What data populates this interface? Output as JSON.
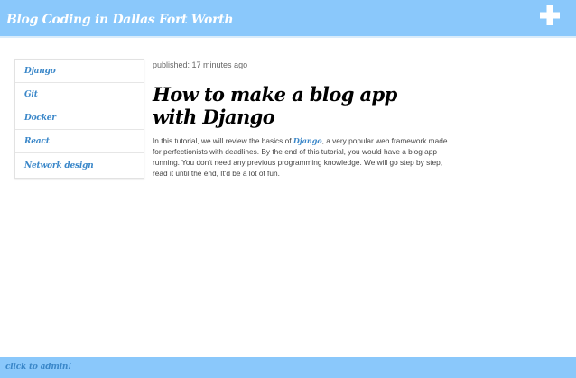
{
  "header": {
    "title": "Blog Coding in Dallas Fort Worth",
    "add_icon": "plus-icon",
    "color": "#8ac8fb"
  },
  "sidebar": {
    "items": [
      {
        "label": "Django"
      },
      {
        "label": "Git"
      },
      {
        "label": "Docker"
      },
      {
        "label": "React"
      },
      {
        "label": "Network design"
      }
    ]
  },
  "post": {
    "published": "published: 17 minutes ago",
    "title": "How to make a blog app with Django",
    "body_before_link": "In this tutorial, we will review the basics of ",
    "link_text": "Django",
    "body_after_link": ", a very popular web framework made for perfectionists with deadlines. By the end of this tutorial, you would have a blog app running. You don't need any previous programming knowledge. We will go step by step, read it until the end, It'd be a lot of fun."
  },
  "footer": {
    "link": "click to admin!"
  },
  "colors": {
    "accent": "#3a87c9",
    "bar": "#8ac8fb"
  }
}
